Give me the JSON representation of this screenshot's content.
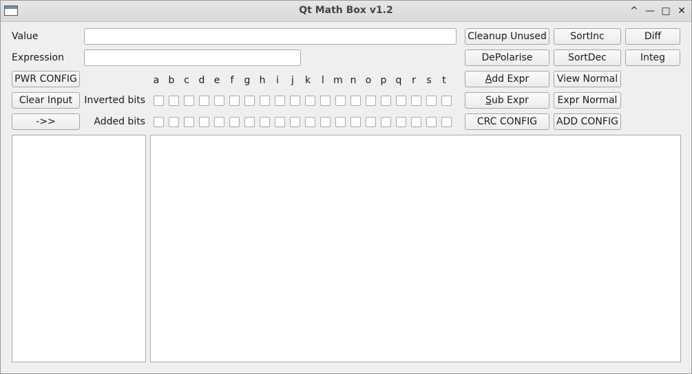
{
  "window": {
    "title": "Qt Math Box v1.2",
    "controls": {
      "minimize": "—",
      "maximize": "□",
      "restore": "^",
      "close": "✕"
    }
  },
  "form": {
    "value_label": "Value",
    "value_input": "",
    "expression_label": "Expression",
    "expression_input": ""
  },
  "buttons": {
    "pwr_config": "PWR CONFIG",
    "clear_input": "Clear Input",
    "arrow": "->>",
    "cleanup_unused": "Cleanup Unused",
    "sortinc": "SortInc",
    "diff": "Diff",
    "depolarise": "DePolarise",
    "sortdec": "SortDec",
    "integ": "Integ",
    "add_expr_mnemonic": "A",
    "add_expr_rest": "dd Expr",
    "view_normal": "View Normal",
    "sub_expr_mnemonic": "S",
    "sub_expr_rest": "ub Expr",
    "expr_normal": "Expr Normal",
    "crc_config": "CRC CONFIG",
    "add_config": "ADD CONFIG"
  },
  "bits": {
    "inverted_label": "Inverted bits",
    "added_label": "Added bits",
    "letters": [
      "a",
      "b",
      "c",
      "d",
      "e",
      "f",
      "g",
      "h",
      "i",
      "j",
      "k",
      "l",
      "m",
      "n",
      "o",
      "p",
      "q",
      "r",
      "s",
      "t"
    ]
  }
}
